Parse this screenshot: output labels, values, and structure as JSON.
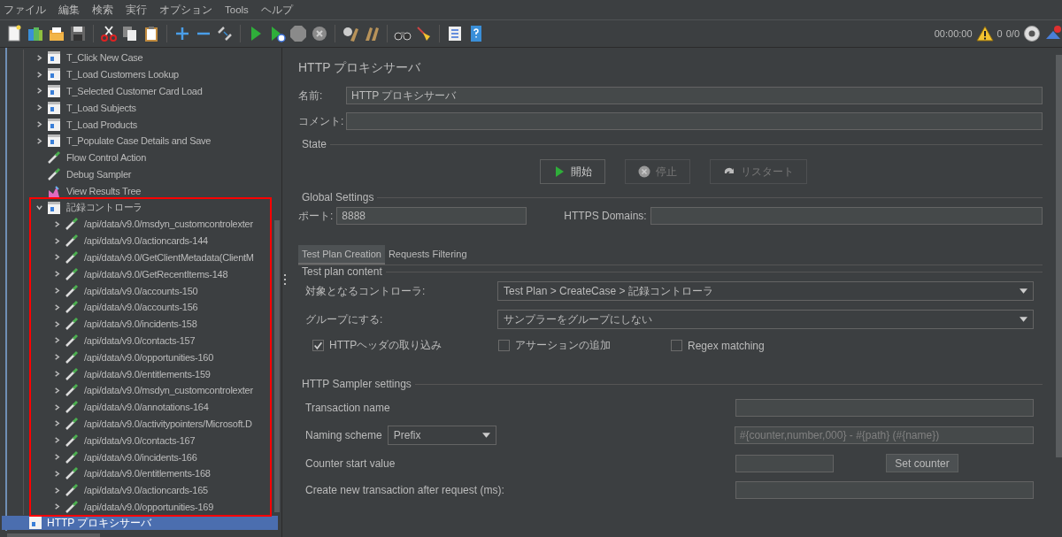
{
  "menu": [
    "ファイル",
    "編集",
    "検索",
    "実行",
    "オプション",
    "Tools",
    "ヘルプ"
  ],
  "status": {
    "timer": "00:00:00",
    "errors": "0",
    "threads": "0/0"
  },
  "tree": {
    "branch_items": [
      {
        "label": "T_Click New Case",
        "kind": "transaction",
        "expanded": false,
        "selected": false
      },
      {
        "label": "T_Load Customers Lookup",
        "kind": "transaction",
        "expanded": false,
        "selected": false
      },
      {
        "label": "T_Selected Customer Card Load",
        "kind": "transaction",
        "expanded": false,
        "selected": false
      },
      {
        "label": "T_Load Subjects",
        "kind": "transaction",
        "expanded": false,
        "selected": false
      },
      {
        "label": "T_Load Products",
        "kind": "transaction",
        "expanded": false,
        "selected": false
      },
      {
        "label": "T_Populate Case Details and Save",
        "kind": "transaction",
        "expanded": false,
        "selected": false
      },
      {
        "label": "Flow Control Action",
        "kind": "sampler",
        "selected": false
      },
      {
        "label": "Debug Sampler",
        "kind": "sampler",
        "selected": false
      },
      {
        "label": "View Results Tree",
        "kind": "listener",
        "selected": false
      },
      {
        "label": "記録コントローラ",
        "kind": "transaction",
        "expanded": true,
        "selected": false,
        "highlighted": true,
        "children": [
          {
            "label": "/api/data/v9.0/msdyn_customcontrolexter",
            "kind": "sampler",
            "expanded": false,
            "selected": false
          },
          {
            "label": "/api/data/v9.0/actioncards-144",
            "kind": "sampler",
            "expanded": false,
            "selected": false
          },
          {
            "label": "/api/data/v9.0/GetClientMetadata(ClientM",
            "kind": "sampler",
            "expanded": false,
            "selected": false
          },
          {
            "label": "/api/data/v9.0/GetRecentItems-148",
            "kind": "sampler",
            "expanded": false,
            "selected": false
          },
          {
            "label": "/api/data/v9.0/accounts-150",
            "kind": "sampler",
            "expanded": false,
            "selected": false
          },
          {
            "label": "/api/data/v9.0/accounts-156",
            "kind": "sampler",
            "expanded": false,
            "selected": false
          },
          {
            "label": "/api/data/v9.0/incidents-158",
            "kind": "sampler",
            "expanded": false,
            "selected": false
          },
          {
            "label": "/api/data/v9.0/contacts-157",
            "kind": "sampler",
            "expanded": false,
            "selected": false
          },
          {
            "label": "/api/data/v9.0/opportunities-160",
            "kind": "sampler",
            "expanded": false,
            "selected": false
          },
          {
            "label": "/api/data/v9.0/entitlements-159",
            "kind": "sampler",
            "expanded": false,
            "selected": false
          },
          {
            "label": "/api/data/v9.0/msdyn_customcontrolexter",
            "kind": "sampler",
            "expanded": false,
            "selected": false
          },
          {
            "label": "/api/data/v9.0/annotations-164",
            "kind": "sampler",
            "expanded": false,
            "selected": false
          },
          {
            "label": "/api/data/v9.0/activitypointers/Microsoft.D",
            "kind": "sampler",
            "expanded": false,
            "selected": false
          },
          {
            "label": "/api/data/v9.0/contacts-167",
            "kind": "sampler",
            "expanded": false,
            "selected": false
          },
          {
            "label": "/api/data/v9.0/incidents-166",
            "kind": "sampler",
            "expanded": false,
            "selected": false
          },
          {
            "label": "/api/data/v9.0/entitlements-168",
            "kind": "sampler",
            "expanded": false,
            "selected": false
          },
          {
            "label": "/api/data/v9.0/actioncards-165",
            "kind": "sampler",
            "expanded": false,
            "selected": false
          },
          {
            "label": "/api/data/v9.0/opportunities-169",
            "kind": "sampler",
            "expanded": false,
            "selected": false
          }
        ]
      }
    ],
    "root_items": [
      {
        "label": "HTTP プロキシサーバ",
        "kind": "transaction",
        "selected": true
      }
    ]
  },
  "panel": {
    "title": "HTTP プロキシサーバ",
    "name_field": {
      "label": "名前:",
      "value": "HTTP プロキシサーバ"
    },
    "comment_field": {
      "label": "コメント:"
    },
    "state": {
      "title": "State",
      "buttons": [
        {
          "label": "開始",
          "kind": "start",
          "disabled": false
        },
        {
          "label": "停止",
          "kind": "stop",
          "disabled": true
        },
        {
          "label": "リスタート",
          "kind": "restart",
          "disabled": true
        }
      ]
    },
    "global_settings": {
      "title": "Global Settings",
      "port": {
        "label": "ポート:",
        "value": "8888"
      },
      "https_domains": {
        "label": "HTTPS Domains:"
      }
    },
    "tabs": [
      {
        "label": "Test Plan Creation",
        "selected": true
      },
      {
        "label": "Requests Filtering",
        "selected": false
      }
    ],
    "test_plan_content": {
      "title": "Test plan content",
      "target_controller": {
        "label": "対象となるコントローラ:",
        "value": "Test Plan > CreateCase > 記録コントローラ"
      },
      "grouping": {
        "label": "グループにする:",
        "value": "サンプラーをグループにしない"
      },
      "checkboxes": [
        {
          "label": "HTTPヘッダの取り込み",
          "checked": true
        },
        {
          "label": "アサーションの追加",
          "checked": false
        },
        {
          "label": "Regex matching",
          "checked": false
        }
      ]
    },
    "http_sampler_settings": {
      "title": "HTTP Sampler settings",
      "transaction_name": {
        "label": "Transaction name"
      },
      "naming_scheme": {
        "label": "Naming scheme",
        "value": "Prefix",
        "format_placeholder": "#{counter,number,000} - #{path} (#{name})"
      },
      "counter_start": {
        "label": "Counter start value",
        "button": "Set counter"
      },
      "new_transaction_after": {
        "label": "Create new transaction after request (ms):"
      }
    }
  }
}
